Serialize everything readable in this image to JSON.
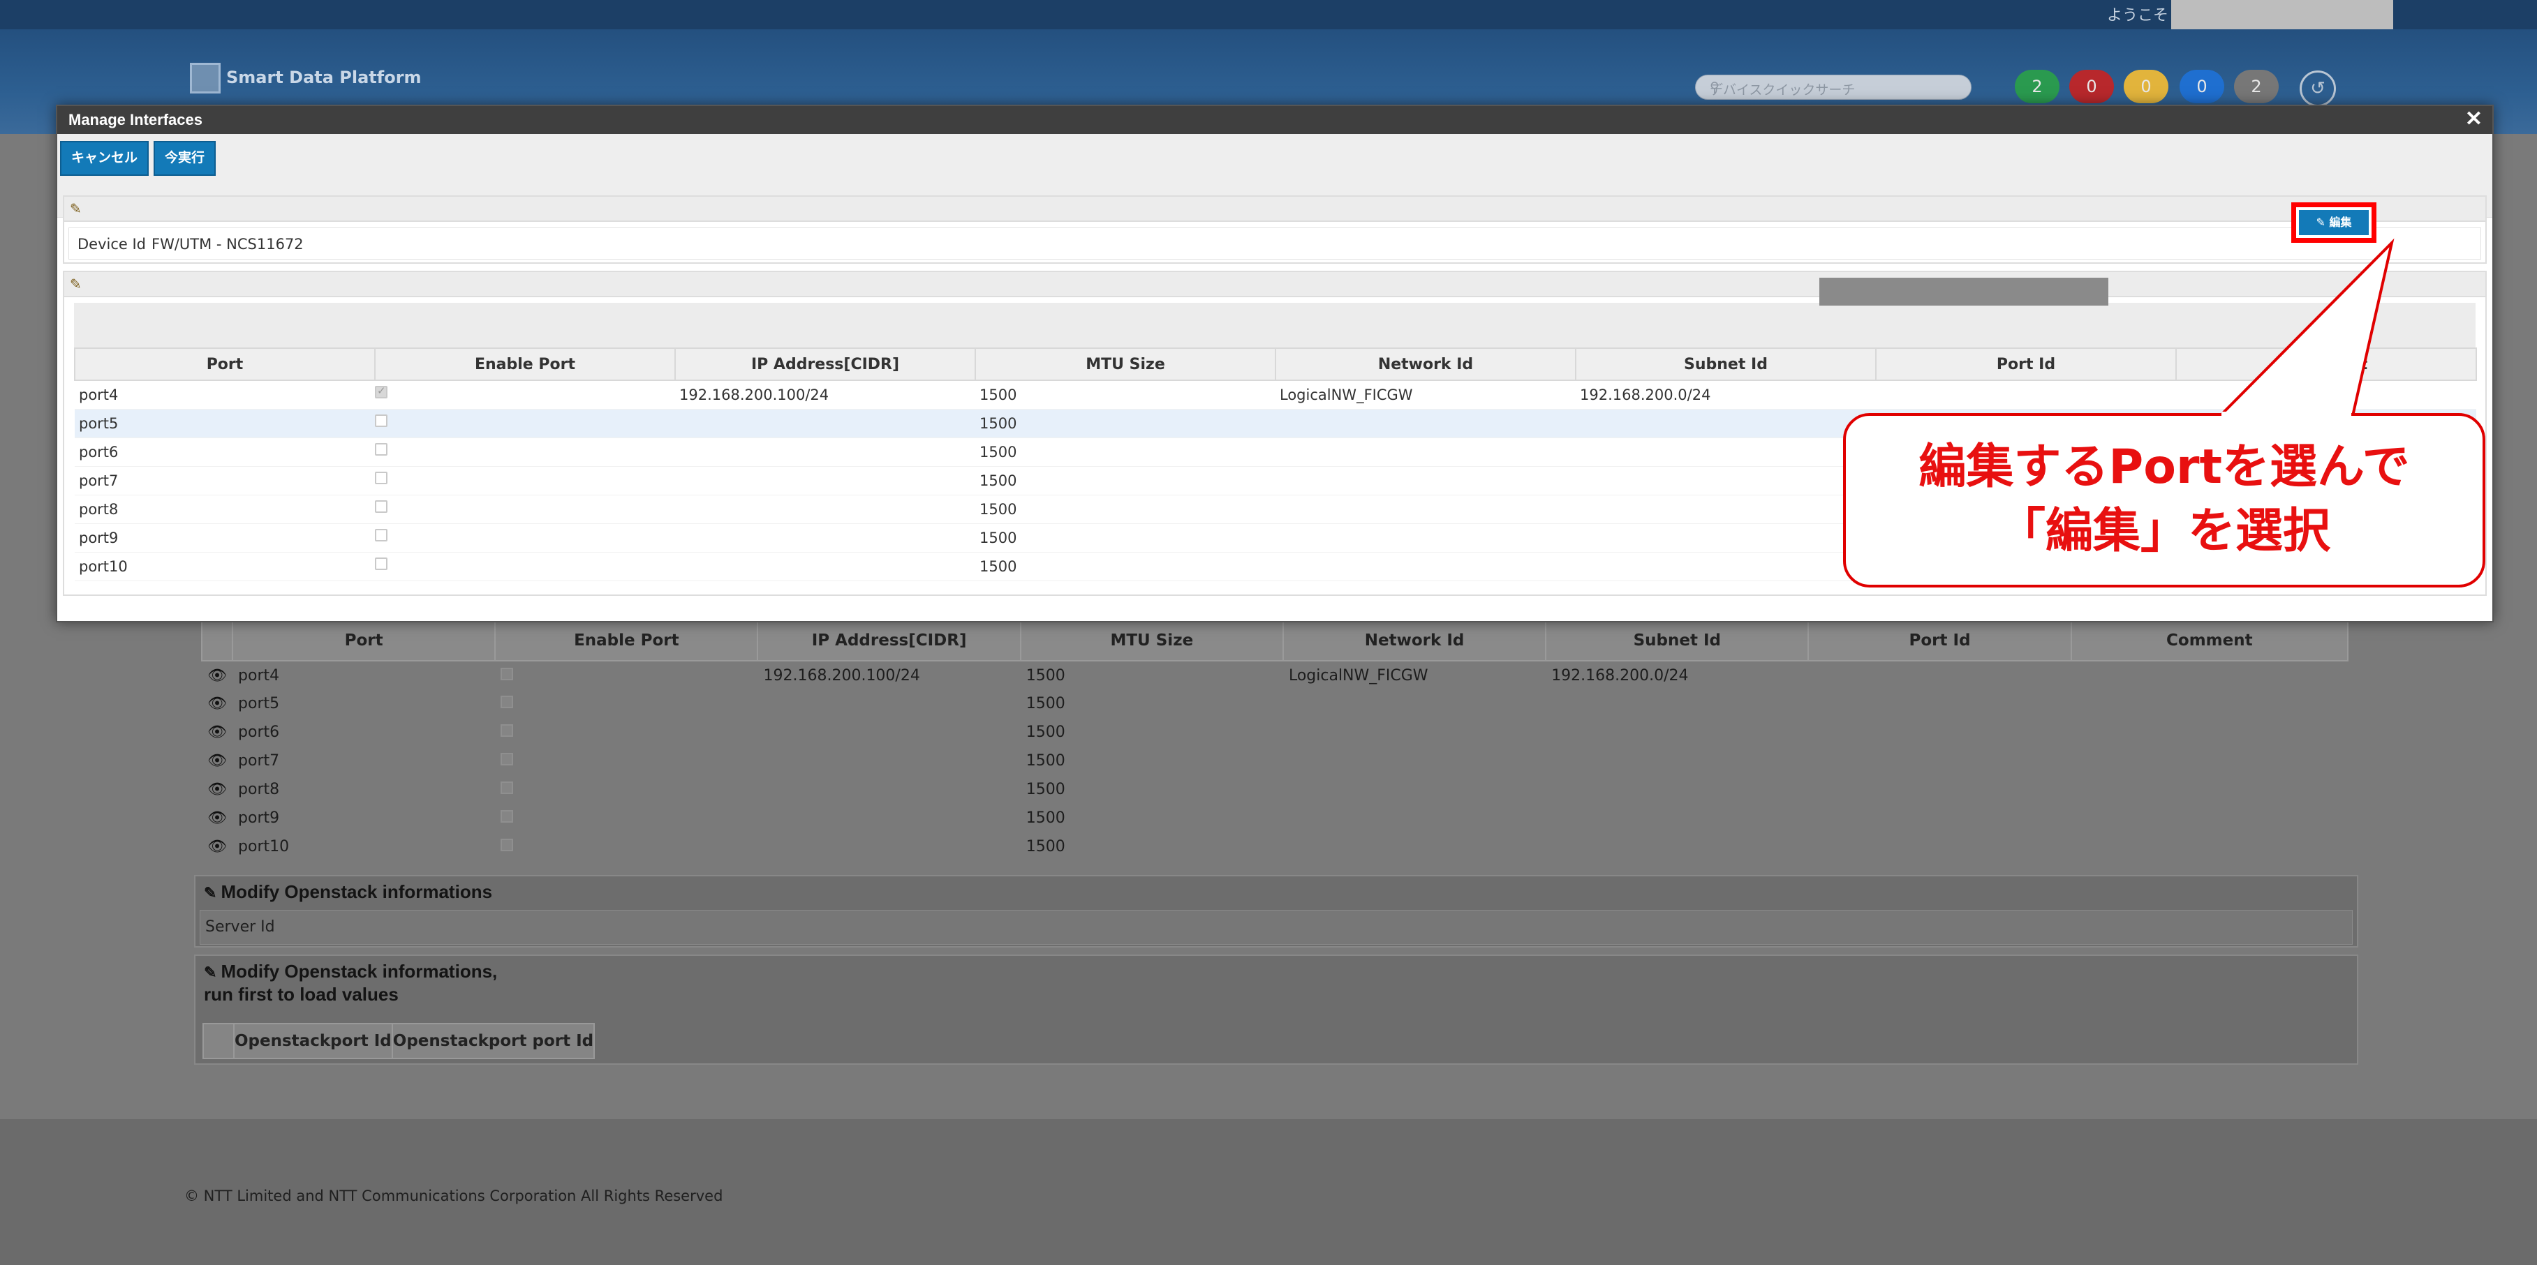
{
  "header": {
    "welcome": "ようこそ",
    "logo_text": "Smart Data Platform",
    "search_placeholder": "デバイスクイックサーチ",
    "status_counts": [
      {
        "value": "2",
        "color": "#2a9a4f"
      },
      {
        "value": "0",
        "color": "#b8282c"
      },
      {
        "value": "0",
        "color": "#e2b43c"
      },
      {
        "value": "0",
        "color": "#1f6fd0"
      },
      {
        "value": "2",
        "color": "#777777"
      }
    ]
  },
  "modal": {
    "title": "Manage Interfaces",
    "close_icon": "close-icon",
    "cancel_label": "キャンセル",
    "run_label": "今実行",
    "device_id_label": "Device Id",
    "device_id_value": "FW/UTM - NCS11672",
    "edit_label": "編集",
    "columns": [
      "Port",
      "Enable Port",
      "IP Address[CIDR]",
      "MTU Size",
      "Network Id",
      "Subnet Id",
      "Port Id",
      "Comment"
    ],
    "rows": [
      {
        "port": "port4",
        "enabled": true,
        "ip": "192.168.200.100/24",
        "mtu": "1500",
        "network": "LogicalNW_FICGW",
        "subnet": "192.168.200.0/24"
      },
      {
        "port": "port5",
        "enabled": false,
        "ip": "",
        "mtu": "1500",
        "network": "",
        "subnet": ""
      },
      {
        "port": "port6",
        "enabled": false,
        "ip": "",
        "mtu": "1500",
        "network": "",
        "subnet": ""
      },
      {
        "port": "port7",
        "enabled": false,
        "ip": "",
        "mtu": "1500",
        "network": "",
        "subnet": ""
      },
      {
        "port": "port8",
        "enabled": false,
        "ip": "",
        "mtu": "1500",
        "network": "",
        "subnet": ""
      },
      {
        "port": "port9",
        "enabled": false,
        "ip": "",
        "mtu": "1500",
        "network": "",
        "subnet": ""
      },
      {
        "port": "port10",
        "enabled": false,
        "ip": "",
        "mtu": "1500",
        "network": "",
        "subnet": ""
      }
    ]
  },
  "callout": {
    "line1": "編集するPortを選んで",
    "line2": "「編集」を選択"
  },
  "background": {
    "columns": [
      "Port",
      "Enable Port",
      "IP Address[CIDR]",
      "MTU Size",
      "Network Id",
      "Subnet Id",
      "Port Id",
      "Comment"
    ],
    "rows": [
      {
        "port": "port4",
        "enabled": true,
        "ip": "192.168.200.100/24",
        "mtu": "1500",
        "network": "LogicalNW_FICGW",
        "subnet": "192.168.200.0/24"
      },
      {
        "port": "port5",
        "enabled": false,
        "ip": "",
        "mtu": "1500",
        "network": "",
        "subnet": ""
      },
      {
        "port": "port6",
        "enabled": false,
        "ip": "",
        "mtu": "1500",
        "network": "",
        "subnet": ""
      },
      {
        "port": "port7",
        "enabled": false,
        "ip": "",
        "mtu": "1500",
        "network": "",
        "subnet": ""
      },
      {
        "port": "port8",
        "enabled": false,
        "ip": "",
        "mtu": "1500",
        "network": "",
        "subnet": ""
      },
      {
        "port": "port9",
        "enabled": false,
        "ip": "",
        "mtu": "1500",
        "network": "",
        "subnet": ""
      },
      {
        "port": "port10",
        "enabled": false,
        "ip": "",
        "mtu": "1500",
        "network": "",
        "subnet": ""
      }
    ],
    "openstack_title": "Modify Openstack informations",
    "server_id_label": "Server Id",
    "openstack_ports_title_line1": "Modify Openstack informations,",
    "openstack_ports_title_line2": "run first to load values",
    "openstack_columns": [
      "Openstackport Id",
      "Openstackport port Id"
    ],
    "footer": "© NTT Limited and NTT Communications Corporation All Rights Reserved"
  }
}
